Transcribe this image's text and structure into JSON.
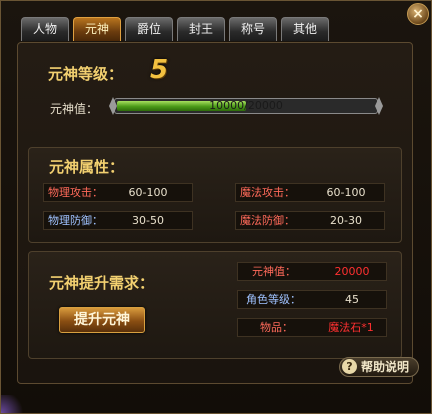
{
  "tabs": [
    {
      "label": "人物",
      "active": false
    },
    {
      "label": "元神",
      "active": true
    },
    {
      "label": "爵位",
      "active": false
    },
    {
      "label": "封王",
      "active": false
    },
    {
      "label": "称号",
      "active": false
    },
    {
      "label": "其他",
      "active": false
    }
  ],
  "level": {
    "label": "元神等级：",
    "value": "5"
  },
  "progress": {
    "label": "元神值：",
    "text": "10000/20000",
    "current": 10000,
    "max": 20000
  },
  "attributes": {
    "title": "元神属性：",
    "items": [
      {
        "key": "物理攻击：",
        "value": "60-100"
      },
      {
        "key": "魔法攻击：",
        "value": "60-100"
      },
      {
        "key": "物理防御：",
        "value": "30-50"
      },
      {
        "key": "魔法防御：",
        "value": "20-30"
      }
    ]
  },
  "requirements": {
    "title": "元神提升需求：",
    "items": [
      {
        "key": "元神值：",
        "value": "20000"
      },
      {
        "key": "角色等级：",
        "value": "45"
      },
      {
        "key": "物品：",
        "value": "魔法石*1"
      }
    ],
    "button_label": "提升元神"
  },
  "help": {
    "icon": "?",
    "label": "帮助说明"
  },
  "close_icon": "×",
  "colors": {
    "accent_gold": "#f2d070",
    "progress_green": "#4a9a18",
    "requirement_red": "#ff3030",
    "attribute_blue": "#9fc2ff",
    "attribute_red": "#ff6a5a"
  }
}
